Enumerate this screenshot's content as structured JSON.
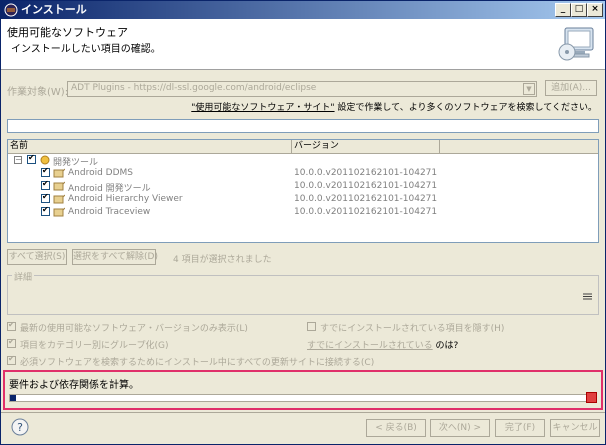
{
  "window": {
    "title": "インストール"
  },
  "header": {
    "title": "使用可能なソフトウェア",
    "subtitle": "インストールしたい項目の確認。"
  },
  "work_target": {
    "label": "作業対象(W):",
    "value": "ADT Plugins - https://dl-ssl.google.com/android/eclipse",
    "add_button": "追加(A)..."
  },
  "sites_hint": {
    "link": "\"使用可能なソフトウェア・サイト\"",
    "text": " 設定で作業して、より多くのソフトウェアを検索してください。"
  },
  "table": {
    "columns": [
      "名前",
      "バージョン"
    ],
    "group": {
      "name": "開発ツール"
    },
    "rows": [
      {
        "name": "Android DDMS",
        "version": "10.0.0.v201102162101-104271"
      },
      {
        "name": "Android 開発ツール",
        "version": "10.0.0.v201102162101-104271"
      },
      {
        "name": "Android Hierarchy Viewer",
        "version": "10.0.0.v201102162101-104271"
      },
      {
        "name": "Android Traceview",
        "version": "10.0.0.v201102162101-104271"
      }
    ]
  },
  "selection": {
    "select_all": "すべて選択(S)",
    "deselect_all": "選択をすべて解除(D)",
    "status": "4 項目が選択されました"
  },
  "details": {
    "legend": "詳細"
  },
  "options": {
    "latest_only": "最新の使用可能なソフトウェア・バージョンのみ表示(L)",
    "hide_installed": "すでにインストールされている項目を隠す(H)",
    "group_by_category": "項目をカテゴリー別にグループ化(G)",
    "installed_link": "すでにインストールされている",
    "installed_suffix": " のは?",
    "contact_all_sites": "必須ソフトウェアを検索するためにインストール中にすべての更新サイトに接続する(C)"
  },
  "progress": {
    "text": "要件および依存関係を計算。",
    "value_percent": 1
  },
  "buttons": {
    "back": "< 戻る(B)",
    "next": "次へ(N) >",
    "finish": "完了(F)",
    "cancel": "キャンセル"
  },
  "colors": {
    "accent": "#0a246a",
    "highlight_border": "#e0306a"
  }
}
